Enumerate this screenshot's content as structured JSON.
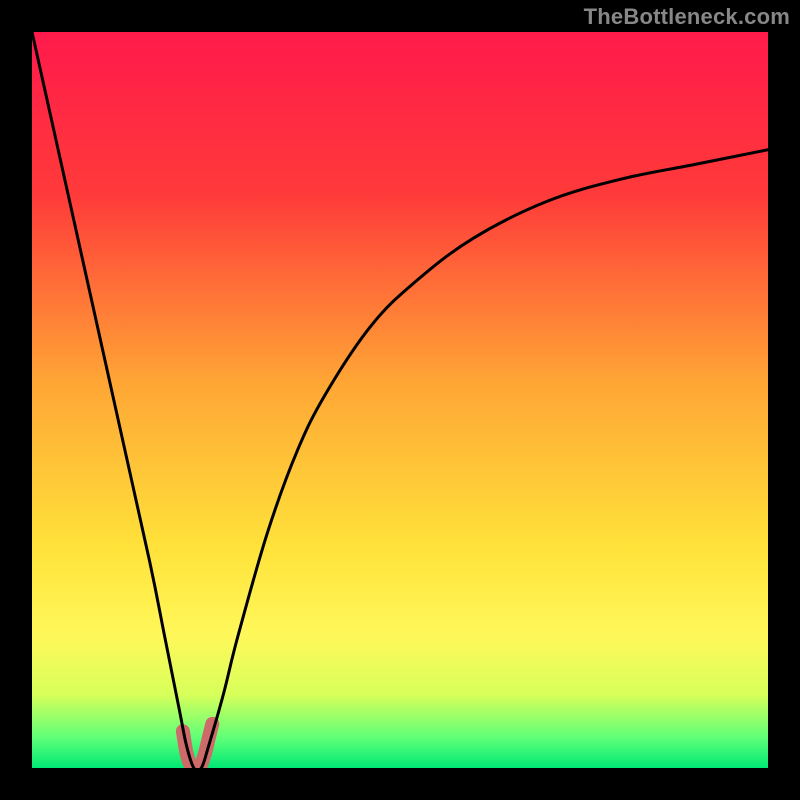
{
  "watermark": "TheBottleneck.com",
  "chart_data": {
    "type": "line",
    "title": "",
    "xlabel": "",
    "ylabel": "",
    "xlim": [
      0,
      100
    ],
    "ylim": [
      0,
      100
    ],
    "grid": false,
    "series": [
      {
        "name": "bottleneck-curve",
        "color": "#000000",
        "x": [
          0,
          4,
          8,
          12,
          16,
          18,
          20,
          21,
          22,
          23,
          24,
          26,
          28,
          32,
          36,
          40,
          46,
          52,
          60,
          70,
          80,
          90,
          100
        ],
        "y": [
          100,
          82,
          64,
          46,
          28,
          18,
          8,
          3,
          0,
          0,
          3,
          10,
          18,
          32,
          43,
          51,
          60,
          66,
          72,
          77,
          80,
          82,
          84
        ]
      }
    ],
    "highlight": {
      "name": "bottleneck-minimum",
      "color": "#cf6a6a",
      "x": [
        20.5,
        21,
        21.5,
        22,
        22.5,
        23,
        23.5,
        24,
        24.5
      ],
      "y": [
        5,
        2,
        0.5,
        0,
        0,
        0.5,
        2,
        4,
        6
      ]
    },
    "gradient_stops": [
      {
        "pct": 0,
        "color": "#ff1a4b"
      },
      {
        "pct": 22,
        "color": "#ff3a3a"
      },
      {
        "pct": 48,
        "color": "#ffa735"
      },
      {
        "pct": 70,
        "color": "#ffe23a"
      },
      {
        "pct": 82,
        "color": "#fff85a"
      },
      {
        "pct": 90,
        "color": "#d8ff5a"
      },
      {
        "pct": 96,
        "color": "#5cff78"
      },
      {
        "pct": 100,
        "color": "#00e874"
      }
    ]
  }
}
